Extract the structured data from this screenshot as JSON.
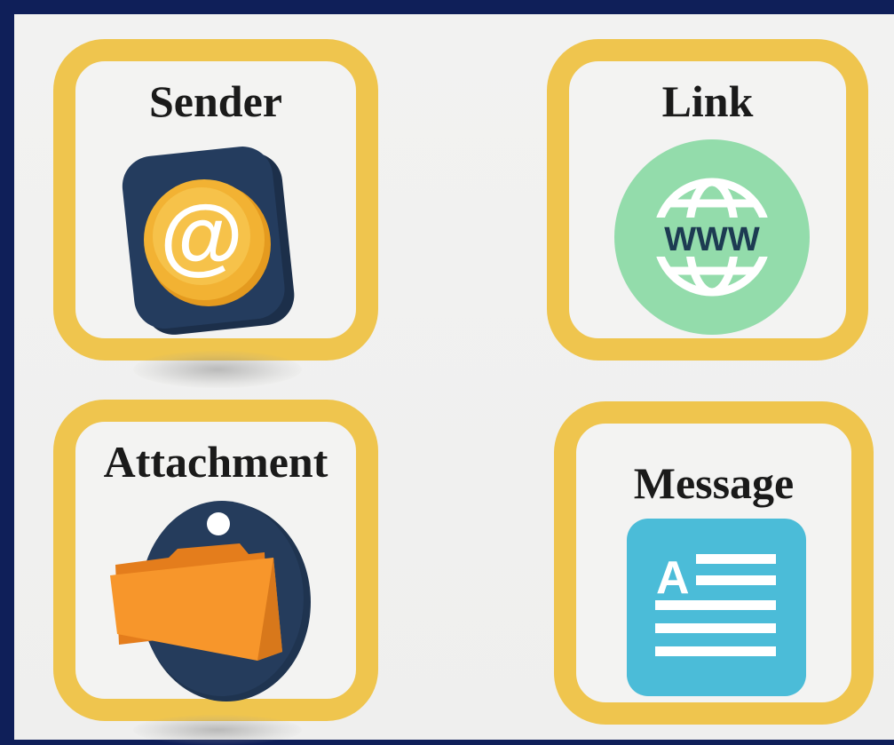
{
  "cards": [
    {
      "title": "Sender",
      "icon": "at-sign-icon"
    },
    {
      "title": "Link",
      "icon": "globe-www-icon"
    },
    {
      "title": "Attachment",
      "icon": "folder-icon"
    },
    {
      "title": "Message",
      "icon": "document-text-icon"
    }
  ],
  "icon_texts": {
    "at": "@",
    "www": "WWW",
    "doc_letter": "A"
  },
  "colors": {
    "frame": "#0f1f59",
    "card_border": "#efc54e",
    "panel": "#f2f2f1",
    "sender_tile": "#243c5e",
    "sender_coin": "#f2b233",
    "link_circle": "#93dcab",
    "folder": "#f7962b",
    "attachment_disc": "#253c5c",
    "message_tile": "#4bbcd8"
  }
}
